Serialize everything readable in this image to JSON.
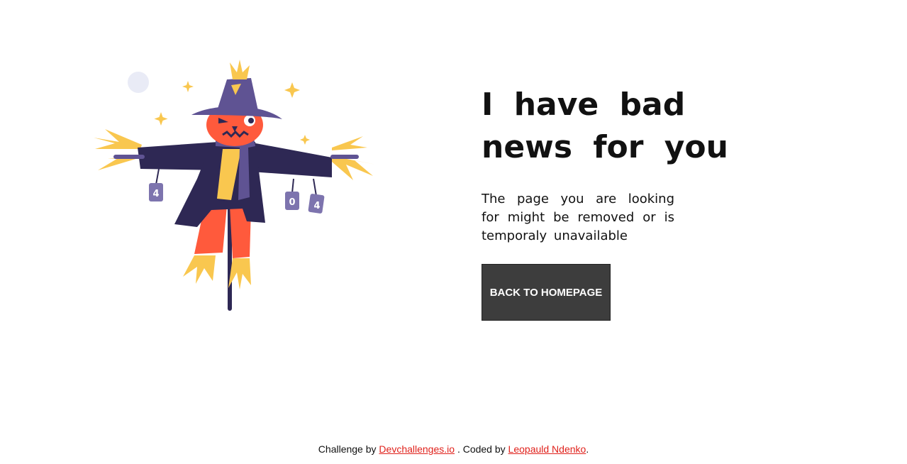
{
  "page": {
    "headline": "I have bad news for you",
    "subtext": "The page you are looking for might be removed or is temporaly unavailable",
    "button_label": "BACK TO HOMEPAGE"
  },
  "illustration": {
    "can_left_label": "4",
    "can_middle_label": "0",
    "can_right_label": "4"
  },
  "footer": {
    "prefix": "Challenge by",
    "challenge_link": "Devchallenges.io",
    "middle": ". Coded by",
    "author_link": "Leopauld Ndenko",
    "suffix": "."
  },
  "colors": {
    "button_bg": "#3d3d3d",
    "link": "#e0211b",
    "coat": "#2e2854",
    "hat": "#5f5393",
    "face": "#ff5a3c",
    "straw": "#f9c74f"
  }
}
